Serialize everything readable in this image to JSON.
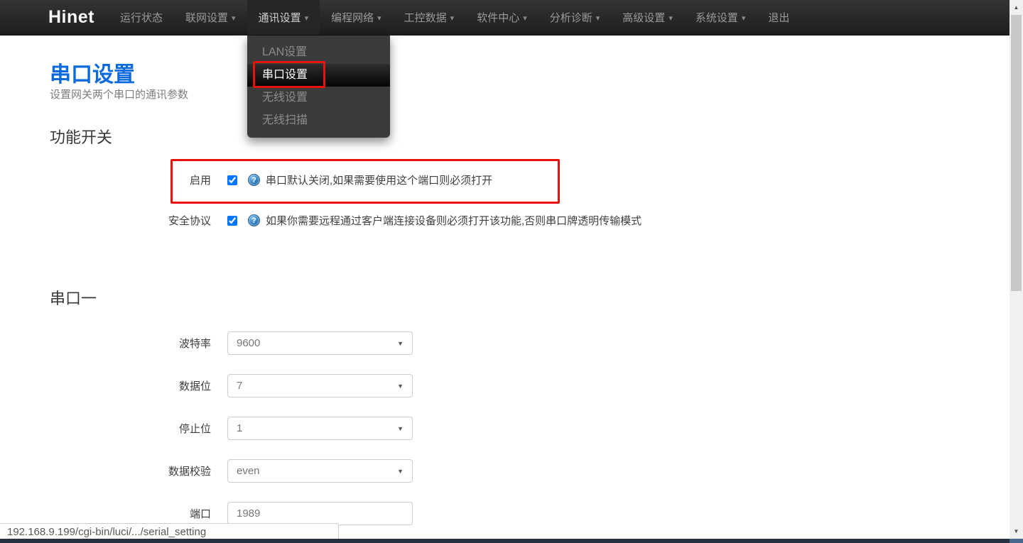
{
  "navbar": {
    "brand": "Hinet",
    "items": [
      {
        "label": "运行状态",
        "caret": false
      },
      {
        "label": "联网设置",
        "caret": true
      },
      {
        "label": "通讯设置",
        "caret": true,
        "open": true
      },
      {
        "label": "编程网络",
        "caret": true
      },
      {
        "label": "工控数据",
        "caret": true
      },
      {
        "label": "软件中心",
        "caret": true
      },
      {
        "label": "分析诊断",
        "caret": true
      },
      {
        "label": "高级设置",
        "caret": true
      },
      {
        "label": "系统设置",
        "caret": true
      },
      {
        "label": "退出",
        "caret": false
      }
    ]
  },
  "dropdown": {
    "items": [
      {
        "label": "LAN设置",
        "active": false
      },
      {
        "label": "串口设置",
        "active": true
      },
      {
        "label": "无线设置",
        "active": false
      },
      {
        "label": "无线扫描",
        "active": false
      }
    ]
  },
  "page": {
    "title": "串口设置",
    "subtitle": "设置网关两个串口的通讯参数"
  },
  "sections": {
    "switches": {
      "heading": "功能开关",
      "rows": [
        {
          "label": "启用",
          "checked": true,
          "help": "串口默认关闭,如果需要使用这个端口则必须打开"
        },
        {
          "label": "安全协议",
          "checked": true,
          "help": "如果你需要远程通过客户端连接设备则必须打开该功能,否则串口牌透明传输模式"
        }
      ]
    },
    "serial1": {
      "heading": "串口一",
      "fields": [
        {
          "label": "波特率",
          "type": "select",
          "value": "9600"
        },
        {
          "label": "数据位",
          "type": "select",
          "value": "7"
        },
        {
          "label": "停止位",
          "type": "select",
          "value": "1"
        },
        {
          "label": "数据校验",
          "type": "select",
          "value": "even"
        },
        {
          "label": "端口",
          "type": "text",
          "value": "1989"
        }
      ]
    }
  },
  "statusbar": {
    "url": "192.168.9.199/cgi-bin/luci/.../serial_setting"
  },
  "glyphs": {
    "caret_down": "▾",
    "select_caret": "▼",
    "help": "?",
    "scroll_up": "▲",
    "scroll_down": "▼"
  },
  "colors": {
    "accent_blue": "#0b6ade",
    "annotation_red": "#e8140c",
    "navbar_bg": "#222222"
  }
}
